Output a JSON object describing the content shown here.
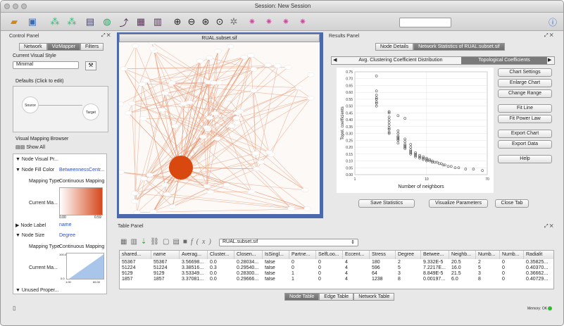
{
  "window": {
    "title": "Session: New Session"
  },
  "toolbar": {
    "search_placeholder": ""
  },
  "control_panel": {
    "title": "Control Panel",
    "tabs": [
      "Network",
      "VizMapper",
      "Filters"
    ],
    "current_visual_style_label": "Current Visual Style",
    "visual_style_value": "Minimal",
    "defaults_label": "Defaults (Click to edit)",
    "defaults_source": "Source",
    "defaults_target": "Target",
    "visual_mapping_browser_label": "Visual Mapping Browser",
    "show_all": "Show All",
    "node_visual_props": "Node Visual Pr...",
    "node_fill_color_label": "Node Fill Color",
    "node_fill_color_value": "BetweennessCentr...",
    "mapping_type_label": "Mapping Type",
    "mapping_type_value": "Continuous Mapping",
    "current_mapping_label": "Current Ma...",
    "fill_scale_min": "0.00",
    "fill_scale_max": "0.59",
    "node_label_label": "Node Label",
    "node_label_value": "name",
    "node_size_label": "Node Size",
    "node_size_value": "Degree",
    "size_mapping_type_value": "Continuous Mapping",
    "size_current_label": "Current Ma...",
    "size_top": "100.0",
    "size_bottom": "0.0",
    "size_min": "1.00",
    "size_max": "65.00",
    "unused_props": "Unused Proper..."
  },
  "network_view": {
    "title": "RUAL.subset.sif"
  },
  "results_panel": {
    "title": "Results Panel",
    "top_tabs": [
      "Node Details",
      "Network Statistics of RUAL.subset.sif"
    ],
    "sub_tabs": [
      "Avg. Clustering Coefficient Distribution",
      "Topological Coefficients"
    ],
    "side_buttons": [
      "Chart Settings",
      "Enlarge Chart",
      "Change Range",
      "Fit Line",
      "Fit Power Law",
      "Export Chart",
      "Export Data",
      "Help"
    ],
    "bottom_buttons": [
      "Save Statistics",
      "Visualize Parameters",
      "Close Tab"
    ]
  },
  "chart_data": {
    "type": "scatter",
    "xlabel": "Number of neighbors",
    "ylabel": "Topol. coefficients",
    "xlim": [
      1,
      70
    ],
    "xscale": "log",
    "x_ticks": [
      1,
      10,
      70
    ],
    "ylim": [
      0,
      0.75
    ],
    "y_ticks": [
      "0.00",
      "0.05",
      "0.10",
      "0.15",
      "0.20",
      "0.25",
      "0.30",
      "0.35",
      "0.40",
      "0.45",
      "0.50",
      "0.55",
      "0.60",
      "0.65",
      "0.70",
      "0.75"
    ],
    "grid": true,
    "x": [
      2,
      2,
      2,
      2,
      2,
      2,
      2,
      2,
      3,
      3,
      3,
      3,
      3,
      3,
      3,
      3,
      3,
      4,
      4,
      4,
      4,
      4,
      4,
      4,
      5,
      5,
      5,
      5,
      5,
      5,
      6,
      6,
      6,
      6,
      6,
      7,
      7,
      7,
      7,
      8,
      8,
      8,
      9,
      9,
      9,
      10,
      10,
      10,
      11,
      11,
      12,
      12,
      13,
      14,
      15,
      16,
      17,
      18,
      20,
      22,
      25,
      28,
      35,
      45,
      60,
      4,
      5,
      3,
      6
    ],
    "y": [
      0.72,
      0.61,
      0.58,
      0.56,
      0.55,
      0.53,
      0.52,
      0.5,
      0.46,
      0.42,
      0.4,
      0.38,
      0.36,
      0.34,
      0.33,
      0.31,
      0.3,
      0.32,
      0.3,
      0.28,
      0.27,
      0.26,
      0.25,
      0.23,
      0.26,
      0.24,
      0.22,
      0.21,
      0.2,
      0.19,
      0.2,
      0.18,
      0.17,
      0.16,
      0.15,
      0.16,
      0.15,
      0.14,
      0.13,
      0.14,
      0.13,
      0.12,
      0.13,
      0.12,
      0.11,
      0.12,
      0.11,
      0.1,
      0.11,
      0.1,
      0.1,
      0.09,
      0.09,
      0.09,
      0.08,
      0.08,
      0.07,
      0.07,
      0.06,
      0.06,
      0.05,
      0.05,
      0.04,
      0.04,
      0.03,
      0.43,
      0.41,
      0.45,
      0.22
    ]
  },
  "table_panel": {
    "title": "Table Panel",
    "network_select": "RUAL.subset.sif",
    "columns": [
      "shared...",
      "name",
      "Averag...",
      "Cluster...",
      "Closen...",
      "IsSingl...",
      "Partne...",
      "SelfLoo...",
      "Eccent...",
      "Stress",
      "Degree",
      "Betwee...",
      "Neighb...",
      "Numb...",
      "Numb...",
      "Radialit"
    ],
    "rows": [
      [
        "55367",
        "55367",
        "3.56698...",
        "0.0",
        "0.28034...",
        "false",
        "0",
        "0",
        "4",
        "180",
        "2",
        "9.332E-5",
        "20.5",
        "2",
        "0",
        "0.35825..."
      ],
      [
        "51224",
        "51224",
        "3.38516...",
        "0.3",
        "0.29540...",
        "false",
        "0",
        "0",
        "4",
        "596",
        "5",
        "7.2217E...",
        "16.0",
        "5",
        "0",
        "0.40370..."
      ],
      [
        "9129",
        "9129",
        "3.53349...",
        "0.0",
        "0.28300...",
        "false",
        "1",
        "0",
        "4",
        "64",
        "3",
        "8.849E-5",
        "21.5",
        "3",
        "0",
        "0.36662..."
      ],
      [
        "1857",
        "1857",
        "3.37081...",
        "0.0",
        "0.29666...",
        "false",
        "1",
        "0",
        "4",
        "1238",
        "8",
        "0.00197...",
        "6.0",
        "8",
        "0",
        "0.40729..."
      ]
    ],
    "bottom_tabs": [
      "Node Table",
      "Edge Table",
      "Network Table"
    ]
  },
  "status": {
    "memory": "Memory: OK"
  }
}
